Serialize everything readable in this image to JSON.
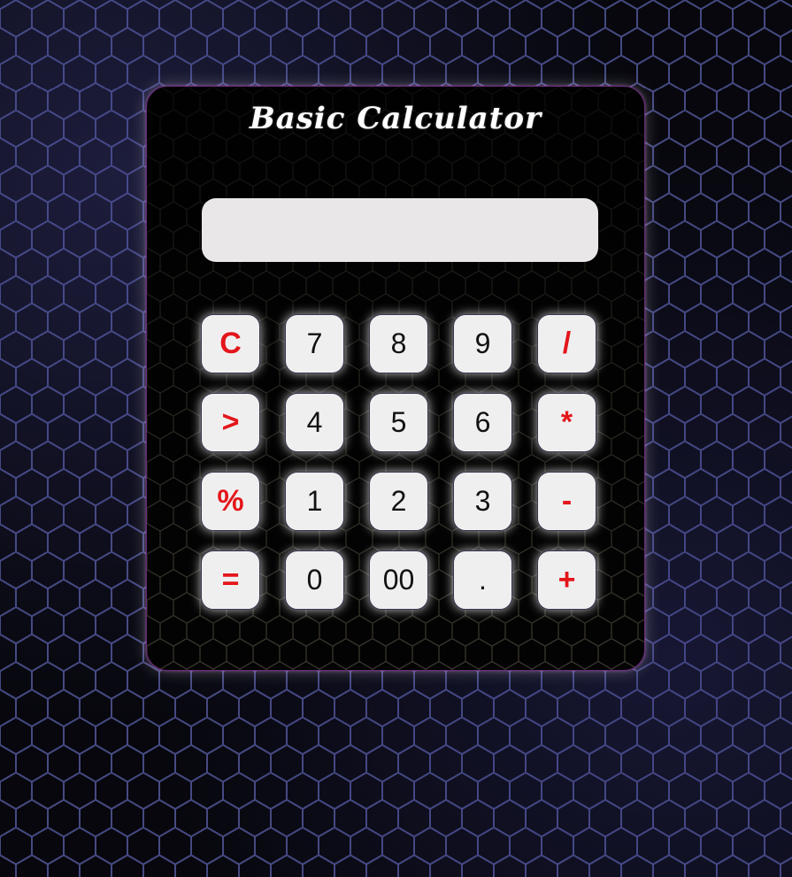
{
  "calculator": {
    "title": "Basic Calculator",
    "display_value": "",
    "keys": [
      {
        "label": "C",
        "type": "op",
        "name": "clear-button"
      },
      {
        "label": "7",
        "type": "num",
        "name": "digit-7-button"
      },
      {
        "label": "8",
        "type": "num",
        "name": "digit-8-button"
      },
      {
        "label": "9",
        "type": "num",
        "name": "digit-9-button"
      },
      {
        "label": "/",
        "type": "op",
        "name": "divide-button"
      },
      {
        "label": ">",
        "type": "op",
        "name": "backspace-button"
      },
      {
        "label": "4",
        "type": "num",
        "name": "digit-4-button"
      },
      {
        "label": "5",
        "type": "num",
        "name": "digit-5-button"
      },
      {
        "label": "6",
        "type": "num",
        "name": "digit-6-button"
      },
      {
        "label": "*",
        "type": "op",
        "name": "multiply-button"
      },
      {
        "label": "%",
        "type": "op",
        "name": "percent-button"
      },
      {
        "label": "1",
        "type": "num",
        "name": "digit-1-button"
      },
      {
        "label": "2",
        "type": "num",
        "name": "digit-2-button"
      },
      {
        "label": "3",
        "type": "num",
        "name": "digit-3-button"
      },
      {
        "label": "-",
        "type": "op",
        "name": "subtract-button"
      },
      {
        "label": "=",
        "type": "op",
        "name": "equals-button"
      },
      {
        "label": "0",
        "type": "num",
        "name": "digit-0-button"
      },
      {
        "label": "00",
        "type": "num",
        "name": "double-zero-button"
      },
      {
        "label": ".",
        "type": "num",
        "name": "decimal-point-button"
      },
      {
        "label": "+",
        "type": "op",
        "name": "add-button"
      }
    ]
  },
  "colors": {
    "operator_text": "#e3161b",
    "digit_text": "#111111",
    "key_background": "#f0eff0",
    "display_background": "#e9e7e8",
    "title_text": "#ffffff",
    "card_border": "#6a2a7a"
  }
}
